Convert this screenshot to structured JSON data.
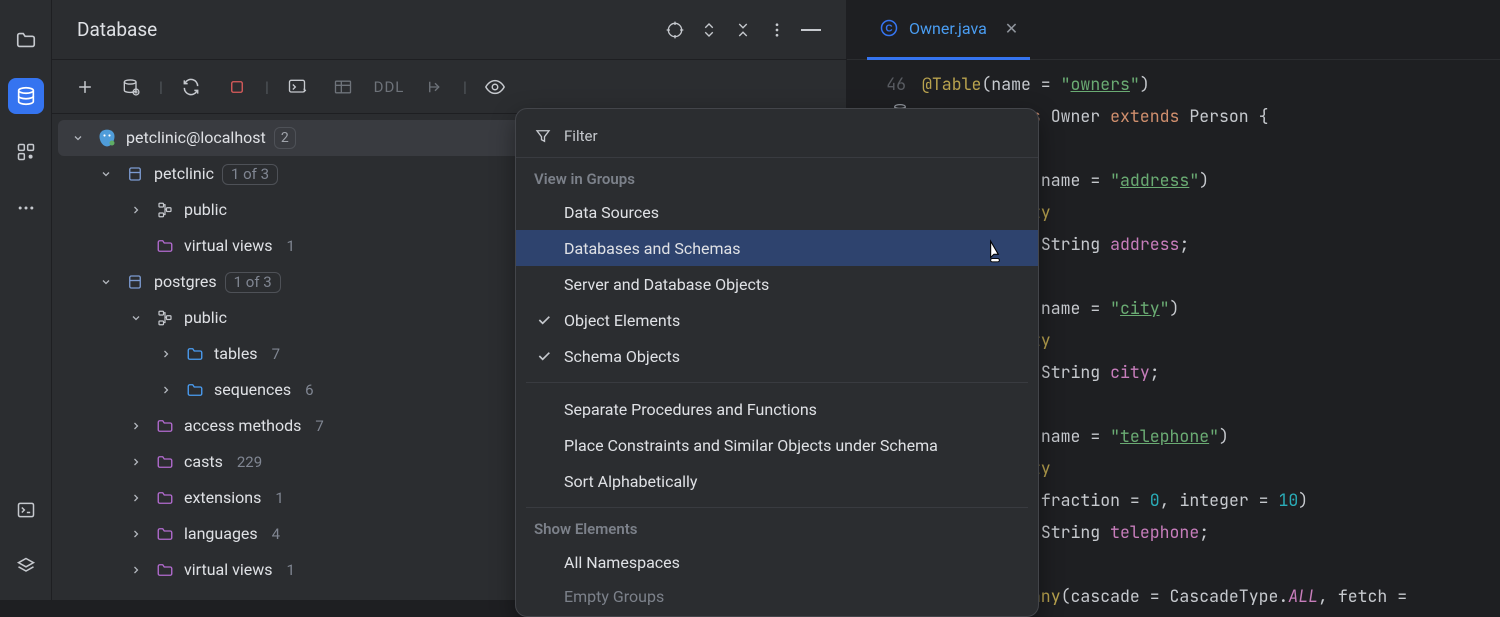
{
  "panel": {
    "title": "Database"
  },
  "toolbar": {
    "ddl": "DDL"
  },
  "tree": {
    "datasource": {
      "label": "petclinic@localhost",
      "badge": "2"
    },
    "db_petclinic": {
      "label": "petclinic",
      "count_text": "1 of 3"
    },
    "db_petclinic_public": {
      "label": "public"
    },
    "db_petclinic_vv": {
      "label": "virtual views",
      "count": "1"
    },
    "db_postgres": {
      "label": "postgres",
      "count_text": "1 of 3"
    },
    "db_postgres_public": {
      "label": "public"
    },
    "pg_tables": {
      "label": "tables",
      "count": "7"
    },
    "pg_sequences": {
      "label": "sequences",
      "count": "6"
    },
    "pg_access": {
      "label": "access methods",
      "count": "7"
    },
    "pg_casts": {
      "label": "casts",
      "count": "229"
    },
    "pg_ext": {
      "label": "extensions",
      "count": "1"
    },
    "pg_lang": {
      "label": "languages",
      "count": "4"
    },
    "pg_vv": {
      "label": "virtual views",
      "count": "1"
    }
  },
  "popup": {
    "filter": "Filter",
    "section_groups": "View in Groups",
    "items_groups": {
      "data_sources": "Data Sources",
      "db_schemas": "Databases and Schemas",
      "server_db_objects": "Server and Database Objects",
      "object_elements": "Object Elements",
      "schema_objects": "Schema Objects"
    },
    "items_misc": {
      "sep_proc": "Separate Procedures and Functions",
      "place_constraints": "Place Constraints and Similar Objects under Schema",
      "sort_alpha": "Sort Alphabetically"
    },
    "section_show": "Show Elements",
    "items_show": {
      "all_ns": "All Namespaces",
      "empty_groups": "Empty Groups"
    }
  },
  "editor": {
    "tab": {
      "filename": "Owner.java"
    },
    "first_line_no": "46",
    "code_html": "<span class='tk-an'>@Table</span><span class='tk-plain'>(name = </span><span class='tk-str'>\"</span><span class='tk-str-u'>owners</span><span class='tk-str'>\"</span><span class='tk-plain'>)</span>\n<span class='tk-kw'>public class </span><span class='tk-type'>Owner </span><span class='tk-kw'>extends </span><span class='tk-type'>Person {</span>\n\n    <span class='tk-an'>@Column</span><span class='tk-plain'>(name = </span><span class='tk-str'>\"</span><span class='tk-str-u'>address</span><span class='tk-str'>\"</span><span class='tk-plain'>)</span>\n    <span class='tk-an'>@NotEmpty</span>\n    <span class='tk-kw'>private </span><span class='tk-type'>String </span><span class='tk-field'>address</span><span class='tk-plain'>;</span>\n\n    <span class='tk-an'>@Column</span><span class='tk-plain'>(name = </span><span class='tk-str'>\"</span><span class='tk-str-u'>city</span><span class='tk-str'>\"</span><span class='tk-plain'>)</span>\n    <span class='tk-an'>@NotEmpty</span>\n    <span class='tk-kw'>private </span><span class='tk-type'>String </span><span class='tk-field'>city</span><span class='tk-plain'>;</span>\n\n    <span class='tk-an'>@Column</span><span class='tk-plain'>(name = </span><span class='tk-str'>\"</span><span class='tk-str-u'>telephone</span><span class='tk-str'>\"</span><span class='tk-plain'>)</span>\n    <span class='tk-an'>@NotEmpty</span>\n    <span class='tk-an'>@Digits</span><span class='tk-plain'>(fraction = </span><span class='tk-num'>0</span><span class='tk-plain'>, integer = </span><span class='tk-num'>10</span><span class='tk-plain'>)</span>\n    <span class='tk-kw'>private </span><span class='tk-type'>String </span><span class='tk-field'>telephone</span><span class='tk-plain'>;</span>\n\n    <span class='tk-an'>@OneToMany</span><span class='tk-plain'>(cascade = CascadeType.</span><span class='tk-const'>ALL</span><span class='tk-plain'>, fetch =</span>"
  }
}
